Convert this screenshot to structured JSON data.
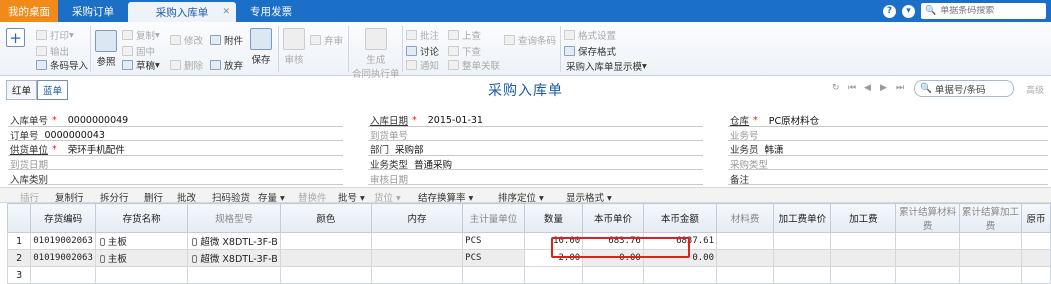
{
  "tabs": [
    {
      "label": "我的桌面"
    },
    {
      "label": "采购订单"
    },
    {
      "label": "采购入库单"
    },
    {
      "label": "专用发票"
    }
  ],
  "top": {
    "help": "?",
    "search_placeholder": "单据条码搜索"
  },
  "toolbar": {
    "print": "打印",
    "export": "输出",
    "barcode_import": "条码导入",
    "reference": "参照",
    "copy": "复制",
    "check": "固中",
    "draft": "草稿",
    "modify": "修改",
    "delete": "删除",
    "attach": "附件",
    "abandon": "放弃",
    "save": "保存",
    "audit": "审核",
    "abandon_audit": "弃审",
    "generate": "生成",
    "generate2": "合同执行单",
    "approve": "批注",
    "discuss": "讨论",
    "notify": "通知",
    "prev": "上查",
    "next": "下查",
    "doc_link": "整单关联",
    "query_barcode": "查询条码",
    "format_setting": "格式设置",
    "save_format": "保存格式",
    "display_template": "采购入库单显示模"
  },
  "mode": {
    "red": "红单",
    "blue": "蓝单"
  },
  "page_title": "采购入库单",
  "doc_search": "单据号/条码",
  "advanced": "高级",
  "header": {
    "doc_no_label": "入库单号",
    "doc_no": "0000000049",
    "date_label": "入库日期",
    "date": "2015-01-31",
    "warehouse_label": "仓库",
    "warehouse": "PC原材料仓",
    "order_no_label": "订单号",
    "order_no": "0000000043",
    "arrival_no_label": "到货单号",
    "biz_no_label": "业务号",
    "supplier_label": "供货单位",
    "supplier": "荣环手机配件",
    "dept_label": "部门",
    "dept": "采购部",
    "salesman_label": "业务员",
    "salesman": "韩潇",
    "arrival_date_label": "到货日期",
    "biz_type_label": "业务类型",
    "biz_type": "普通采购",
    "purchase_type_label": "采购类型",
    "in_type_label": "入库类别",
    "audit_date_label": "审核日期",
    "remark_label": "备注"
  },
  "grid_toolbar": {
    "insert": "插行",
    "copy_row": "复制行",
    "split_row": "拆分行",
    "delete_row": "删行",
    "batch": "批改",
    "scan": "扫码验货",
    "stock": "存量",
    "replace": "替换件",
    "lot": "批号",
    "position": "货位",
    "conversion": "结存换算率",
    "sort": "排序定位",
    "display": "显示格式"
  },
  "grid": {
    "columns": [
      "存货编码",
      "存货名称",
      "规格型号",
      "颜色",
      "内存",
      "主计量单位",
      "数量",
      "本币单价",
      "本币金额",
      "材料费",
      "加工费单价",
      "加工费",
      "累计结算材料费",
      "累计结算加工费",
      "原币"
    ],
    "rows": [
      {
        "idx": "1",
        "code": "01019002063",
        "name": "主板",
        "spec": "超微 X8DTL-3F-B",
        "unit": "PCS",
        "qty": "10.00",
        "price": "683.76",
        "amount": "6837.61"
      },
      {
        "idx": "2",
        "code": "01019002063",
        "name": "主板",
        "spec": "超微 X8DTL-3F-B",
        "unit": "PCS",
        "qty": "2.00",
        "price": "0.00",
        "amount": "0.00"
      },
      {
        "idx": "3"
      }
    ]
  }
}
